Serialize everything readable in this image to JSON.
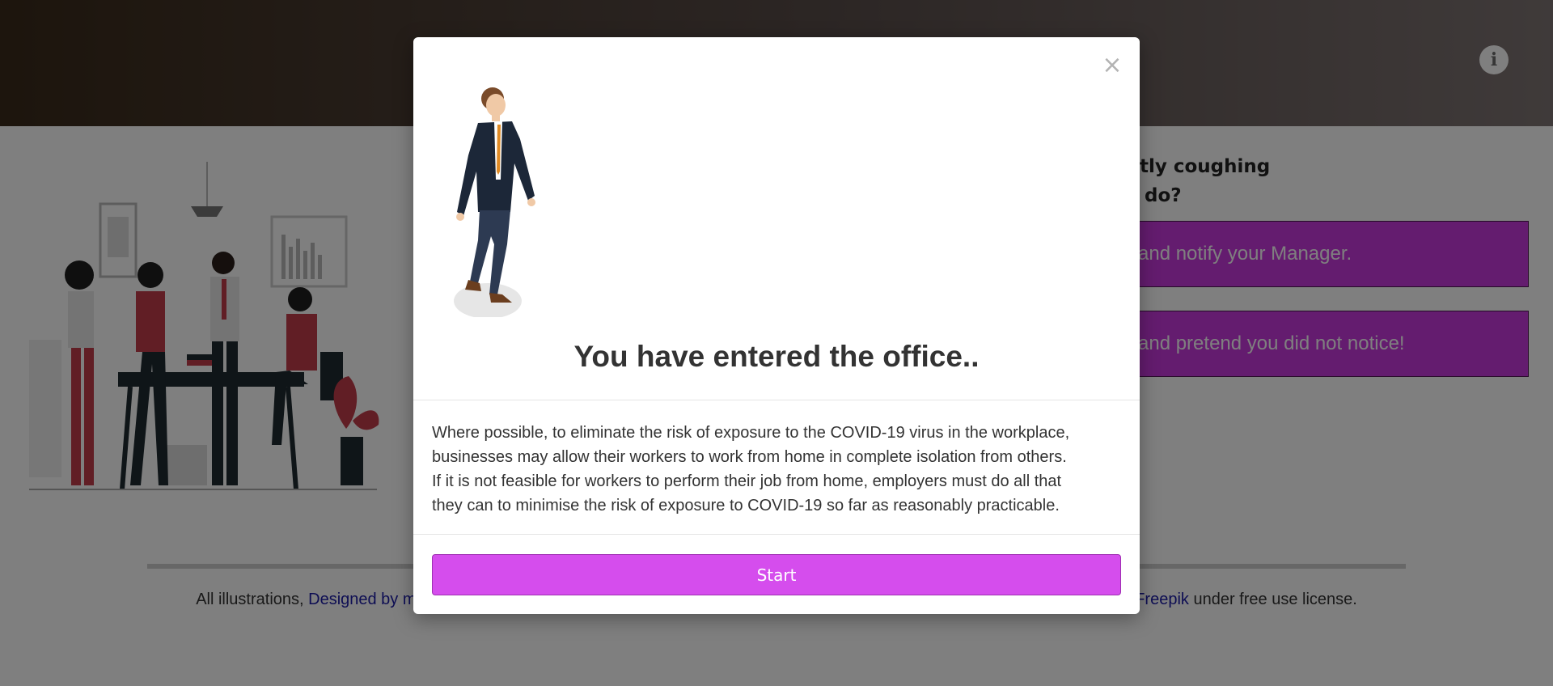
{
  "header": {
    "info_icon": "info-icon",
    "info_glyph": "i"
  },
  "question": {
    "line1": "nstantly coughing",
    "line2": "o you do?"
  },
  "answers": [
    {
      "label": "and notify your Manager."
    },
    {
      "label": "and pretend you did not notice!"
    }
  ],
  "footer": {
    "prefix": "All illustrations, ",
    "link1": "Designed by mac",
    "link2": "y Freepik",
    "suffix": " under free use license."
  },
  "modal": {
    "close_glyph": "×",
    "title": "You have entered the office..",
    "body_lines": [
      "Where possible, to eliminate the risk of exposure to the COVID-19 virus in the workplace,",
      "businesses may allow their workers to work from home in complete isolation from others.",
      "If it is not feasible for workers to perform their job from home, employers must do all that",
      "they can to minimise the risk of exposure to COVID-19 so far as reasonably practicable."
    ],
    "start_label": "Start"
  },
  "colors": {
    "accent": "#d54ded",
    "answer_bg": "#c838de",
    "header_dark": "#3a2a1a"
  }
}
